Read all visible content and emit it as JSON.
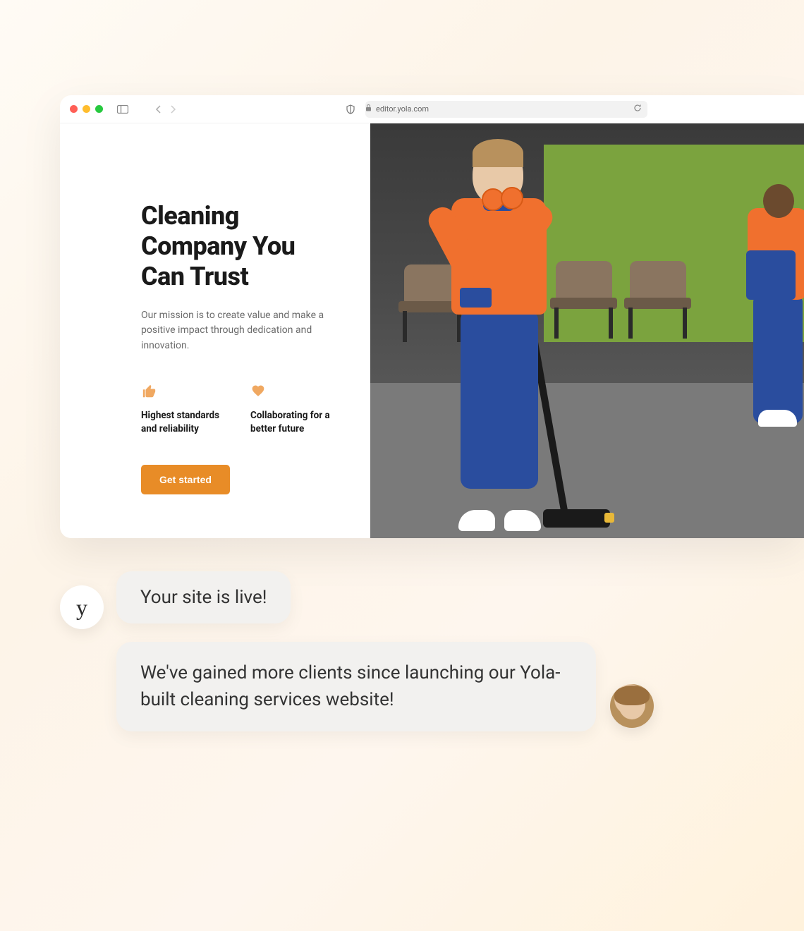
{
  "browser": {
    "url": "editor.yola.com"
  },
  "site": {
    "title": "Cleaning Company You Can Trust",
    "description": "Our mission is to create value and make a positive impact through dedication and innovation.",
    "features": [
      {
        "icon": "thumbs-up",
        "text": "Highest standards and reliability"
      },
      {
        "icon": "heart",
        "text": "Collaborating for a better future"
      }
    ],
    "cta": "Get started"
  },
  "chat": {
    "yola_avatar": "y",
    "bubble1": "Your site is live!",
    "bubble2": "We've gained more clients since launching our Yola-built cleaning services website!"
  }
}
